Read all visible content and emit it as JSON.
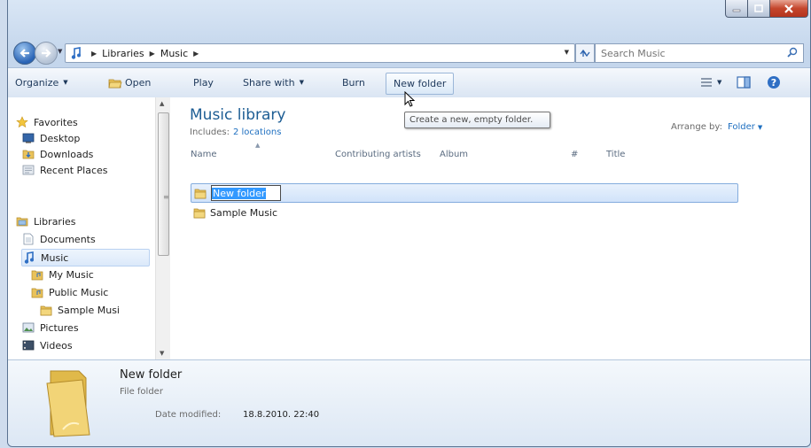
{
  "window": {
    "controls": [
      "minimize",
      "maximize",
      "close"
    ]
  },
  "address_bar": {
    "crumbs": [
      "Libraries",
      "Music"
    ],
    "search_placeholder": "Search Music"
  },
  "toolbar": {
    "organize": "Organize",
    "open": "Open",
    "play": "Play",
    "share_with": "Share with",
    "burn": "Burn",
    "new_folder": "New folder"
  },
  "tooltip": "Create a new, empty folder.",
  "nav_pane": {
    "favorites": "Favorites",
    "desktop": "Desktop",
    "downloads": "Downloads",
    "recent_places": "Recent Places",
    "libraries": "Libraries",
    "documents": "Documents",
    "music": "Music",
    "my_music": "My Music",
    "public_music": "Public Music",
    "sample_music": "Sample Musi",
    "pictures": "Pictures",
    "videos": "Videos"
  },
  "library": {
    "title": "Music library",
    "includes_label": "Includes:",
    "includes_link": "2 locations",
    "arrange_label": "Arrange by:",
    "arrange_value": "Folder"
  },
  "columns": [
    "Name",
    "Contributing artists",
    "Album",
    "#",
    "Title"
  ],
  "files": [
    {
      "name": "New folder",
      "renaming": true
    },
    {
      "name": "Sample Music",
      "renaming": false
    }
  ],
  "details": {
    "name": "New folder",
    "type": "File folder",
    "date_label": "Date modified:",
    "date_value": "18.8.2010. 22:40"
  },
  "colors": {
    "accent": "#1d5d94",
    "link": "#1e6fc0",
    "selection": "#3399ff"
  },
  "icons": [
    "back-arrow-icon",
    "forward-arrow-icon",
    "music-library-icon",
    "refresh-icon",
    "search-icon",
    "folder-icon",
    "star-icon",
    "desktop-icon",
    "document-icon",
    "music-note-icon",
    "pictures-icon",
    "videos-icon",
    "help-icon"
  ]
}
